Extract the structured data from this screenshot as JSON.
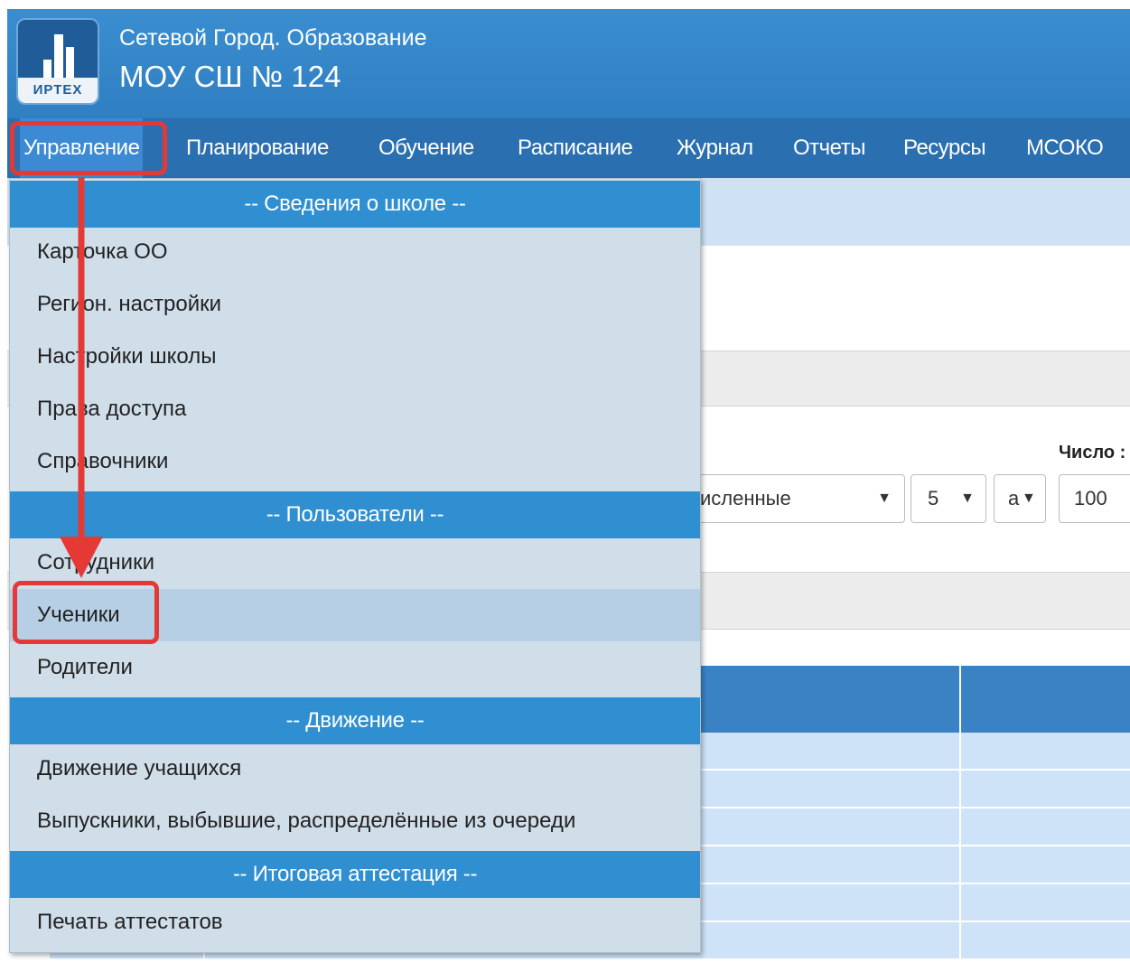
{
  "header": {
    "logo_text": "ИРТЕХ",
    "system_name": "Сетевой Город. Образование",
    "school_name": "МОУ СШ № 124"
  },
  "nav": {
    "items": [
      "Управление",
      "Планирование",
      "Обучение",
      "Расписание",
      "Журнал",
      "Отчеты",
      "Ресурсы",
      "МСОКО"
    ],
    "active": "Управление"
  },
  "menu": {
    "sections": [
      {
        "title": "-- Сведения о школе --",
        "items": [
          "Карточка ОО",
          "Регион. настройки",
          "Настройки школы",
          "Права доступа",
          "Справочники"
        ]
      },
      {
        "title": "-- Пользователи --",
        "items": [
          "Сотрудники",
          "Ученики",
          "Родители"
        ]
      },
      {
        "title": "-- Движение --",
        "items": [
          "Движение учащихся",
          "Выпускники, выбывшие, распределённые из очереди"
        ]
      },
      {
        "title": "-- Итоговая аттестация --",
        "items": [
          "Печать аттестатов"
        ]
      }
    ],
    "highlighted": "Ученики"
  },
  "filters": {
    "status_partial": "исленные",
    "grade": "5",
    "letter": "а",
    "count_label_partial": "Число :",
    "count_value": "100"
  },
  "colors": {
    "header_blue": "#2f7fc2",
    "nav_blue": "#2a6fb0",
    "menu_section": "#2f8fd1",
    "menu_bg": "#d0deea",
    "annotation_red": "#e53935"
  }
}
